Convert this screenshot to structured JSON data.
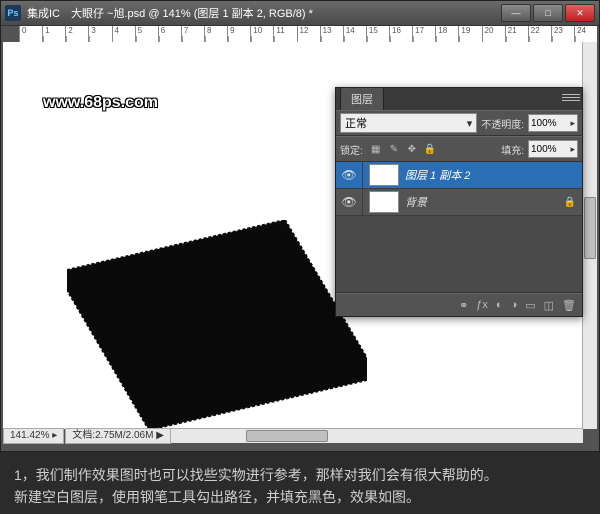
{
  "titlebar": {
    "app_icon": "Ps",
    "title": "集成IC　大眼仔 ~旭.psd @ 141% (图层 1 副本 2, RGB/8) *"
  },
  "ruler": {
    "marks": [
      "0",
      "1",
      "2",
      "3",
      "4",
      "5",
      "6",
      "7",
      "8",
      "9",
      "10",
      "11",
      "12",
      "13",
      "14",
      "15",
      "16",
      "17",
      "18",
      "19",
      "20",
      "21",
      "22",
      "23",
      "24"
    ]
  },
  "watermark": "www.68ps.com",
  "status": {
    "zoom": "141.42%",
    "doc_label": "文档:",
    "doc_size": "2.75M/2.06M"
  },
  "panel": {
    "tab": "图层",
    "blend_mode": "正常",
    "opacity_label": "不透明度:",
    "opacity_value": "100%",
    "lock_label": "锁定:",
    "fill_label": "填充:",
    "fill_value": "100%",
    "layers": [
      {
        "name": "图层 1 副本 2",
        "active": true,
        "checker": true,
        "locked": false
      },
      {
        "name": "背景",
        "active": false,
        "checker": false,
        "locked": true
      }
    ]
  },
  "caption": {
    "line1": "1，我们制作效果图时也可以找些实物进行参考，那样对我们会有很大帮助的。",
    "line2": "新建空白图层，使用钢笔工具勾出路径，并填充黑色，效果如图。"
  }
}
